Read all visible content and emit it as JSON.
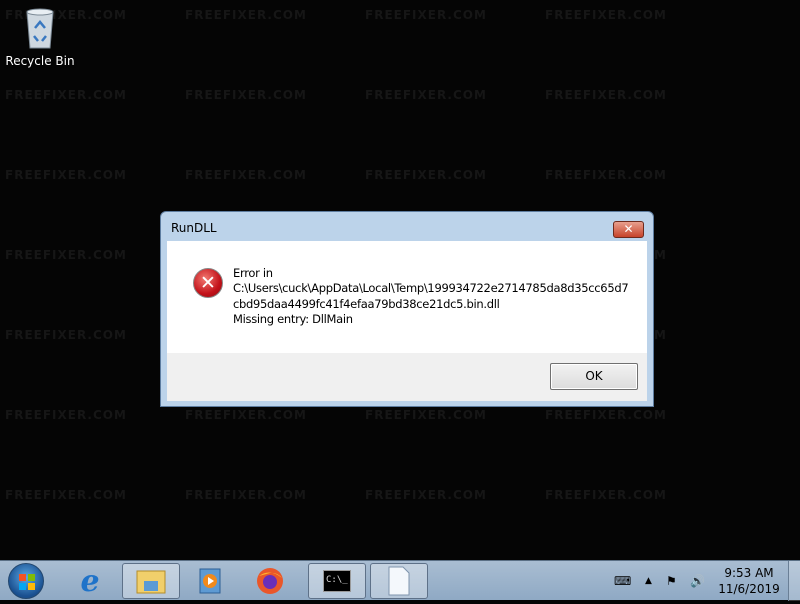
{
  "watermark": "FREEFIXER.COM",
  "desktop": {
    "icons": [
      {
        "label": "Recycle Bin",
        "icon": "recycle-bin-icon"
      }
    ]
  },
  "dialog": {
    "title": "RunDLL",
    "close_label": "✕",
    "icon": "error-icon",
    "message_lines": [
      "Error in",
      "C:\\Users\\cuck\\AppData\\Local\\Temp\\199934722e2714785da8d35cc65d7",
      "cbd95daa4499fc41f4efaa79bd38ce21dc5.bin.dll",
      "Missing entry: DllMain"
    ],
    "ok_label": "OK"
  },
  "taskbar": {
    "items": [
      {
        "name": "internet-explorer",
        "icon": "internet-explorer-icon",
        "active": false
      },
      {
        "name": "windows-explorer",
        "icon": "folder-icon",
        "active": true
      },
      {
        "name": "media-player",
        "icon": "media-player-icon",
        "active": false
      },
      {
        "name": "firefox",
        "icon": "firefox-icon",
        "active": false
      },
      {
        "name": "command-prompt",
        "icon": "cmd-icon",
        "active": true,
        "glyph": "C:\\_"
      },
      {
        "name": "blank-document",
        "icon": "document-icon",
        "active": true
      }
    ],
    "clock": {
      "time": "9:53 AM",
      "date": "11/6/2019"
    }
  }
}
